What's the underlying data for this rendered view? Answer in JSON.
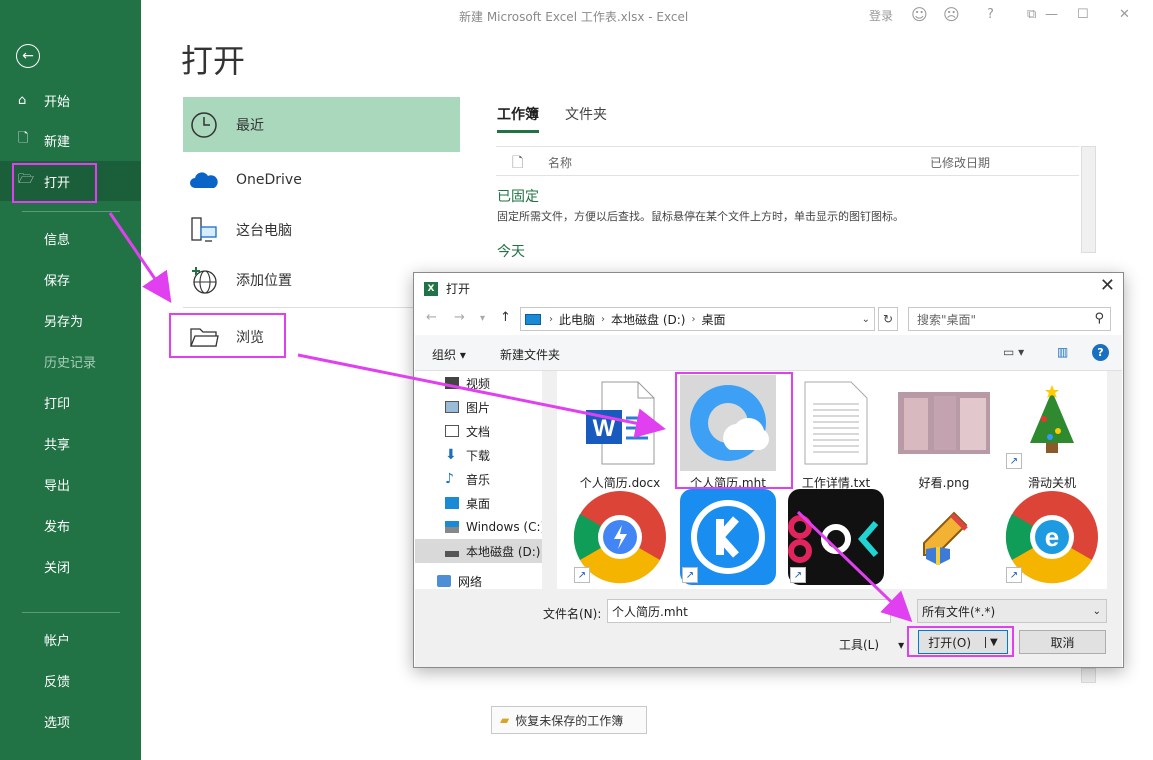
{
  "window": {
    "title": "新建 Microsoft Excel 工作表.xlsx  -  Excel",
    "login": "登录",
    "help": "?"
  },
  "sidebar": {
    "items": [
      {
        "label": "开始"
      },
      {
        "label": "新建"
      },
      {
        "label": "打开"
      },
      {
        "label": "信息"
      },
      {
        "label": "保存"
      },
      {
        "label": "另存为"
      },
      {
        "label": "历史记录"
      },
      {
        "label": "打印"
      },
      {
        "label": "共享"
      },
      {
        "label": "导出"
      },
      {
        "label": "发布"
      },
      {
        "label": "关闭"
      },
      {
        "label": "帐户"
      },
      {
        "label": "反馈"
      },
      {
        "label": "选项"
      }
    ]
  },
  "main": {
    "page_title": "打开",
    "locations": [
      {
        "label": "最近"
      },
      {
        "label": "OneDrive"
      },
      {
        "label": "这台电脑"
      },
      {
        "label": "添加位置"
      },
      {
        "label": "浏览"
      }
    ],
    "tabs": [
      {
        "label": "工作簿"
      },
      {
        "label": "文件夹"
      }
    ],
    "columns": {
      "name": "名称",
      "modified": "已修改日期"
    },
    "pinned_title": "已固定",
    "pinned_hint": "固定所需文件，方便以后查找。鼠标悬停在某个文件上方时，单击显示的图钉图标。",
    "today_title": "今天",
    "recover_label": "恢复未保存的工作簿"
  },
  "dialog": {
    "title": "打开",
    "breadcrumb": [
      "此电脑",
      "本地磁盘 (D:)",
      "桌面"
    ],
    "search_placeholder": "搜索\"桌面\"",
    "organize": "组织 ▾",
    "new_folder": "新建文件夹",
    "tree": [
      {
        "label": "视频"
      },
      {
        "label": "图片"
      },
      {
        "label": "文档"
      },
      {
        "label": "下载"
      },
      {
        "label": "音乐"
      },
      {
        "label": "桌面"
      },
      {
        "label": "Windows (C:)"
      },
      {
        "label": "本地磁盘 (D:)"
      },
      {
        "label": "网络"
      }
    ],
    "files": [
      {
        "name": "个人简历.docx"
      },
      {
        "name": "个人简历.mht"
      },
      {
        "name": "工作详情.txt"
      },
      {
        "name": "好看.png"
      },
      {
        "name": "滑动关机"
      }
    ],
    "filename_label": "文件名(N):",
    "filename_value": "个人简历.mht",
    "filetype_value": "所有文件(*.*)",
    "tools_label": "工具(L)",
    "open_label": "打开(O)",
    "cancel_label": "取消"
  },
  "colors": {
    "excel_green": "#217346",
    "highlight": "#e040f0",
    "selected_location": "#a9d8bd"
  }
}
